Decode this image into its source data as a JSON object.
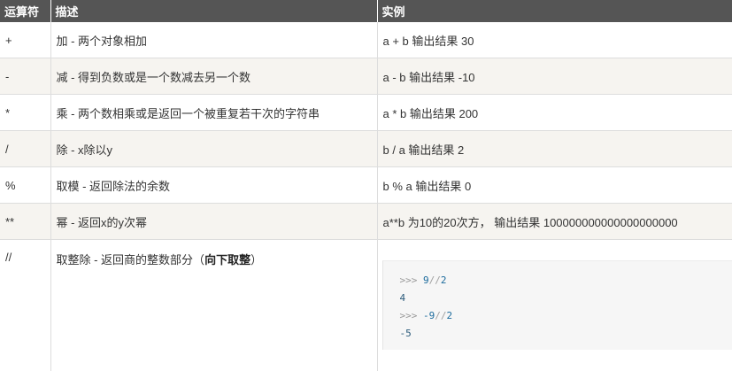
{
  "header": {
    "col1": "运算符",
    "col2": "描述",
    "col3": "实例"
  },
  "rows": [
    {
      "op": "+",
      "desc": "加 - 两个对象相加",
      "example": "a + b 输出结果 30"
    },
    {
      "op": "-",
      "desc": "减 - 得到负数或是一个数减去另一个数",
      "example": "a - b 输出结果 -10"
    },
    {
      "op": "*",
      "desc": "乘 - 两个数相乘或是返回一个被重复若干次的字符串",
      "example": "a * b 输出结果 200"
    },
    {
      "op": "/",
      "desc": "除 - x除以y",
      "example": "b / a 输出结果 2"
    },
    {
      "op": "%",
      "desc": "取模 - 返回除法的余数",
      "example": "b % a 输出结果 0"
    },
    {
      "op": "**",
      "desc": "幂 - 返回x的y次幂",
      "example": "a**b 为10的20次方， 输出结果 100000000000000000000"
    },
    {
      "op": "//",
      "desc_prefix": "取整除 - 返回商的整数部分（",
      "desc_bold": "向下取整",
      "desc_suffix": "）"
    }
  ],
  "code": {
    "line1": {
      "prompt": ">>> ",
      "a": "9",
      "op": "//",
      "b": "2"
    },
    "line2": "4",
    "line3": {
      "prompt": ">>> ",
      "a": "-9",
      "op": "//",
      "b": "2"
    },
    "line4": "-5"
  }
}
